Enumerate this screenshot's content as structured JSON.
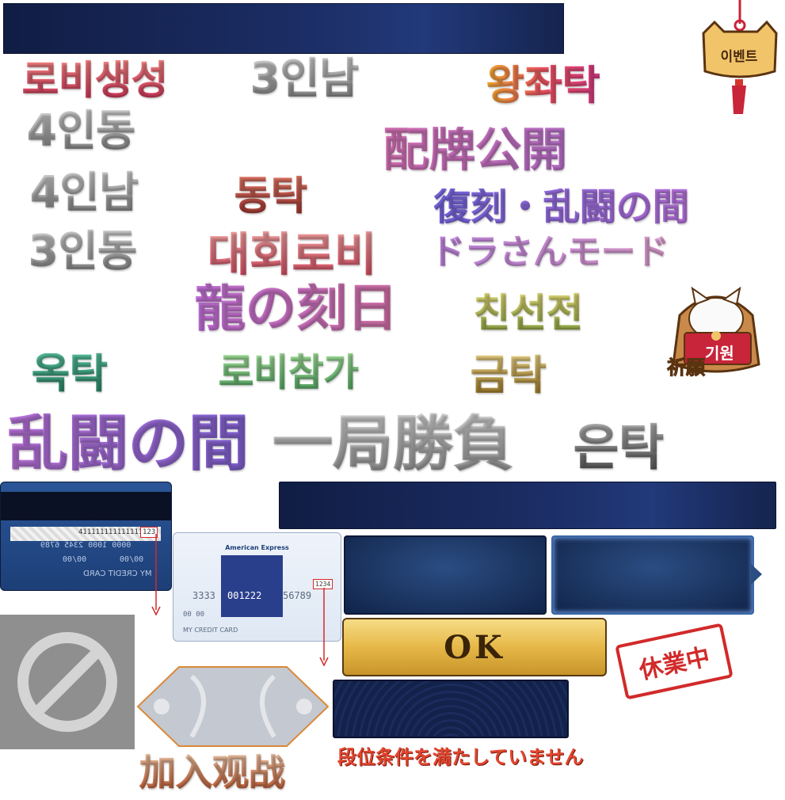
{
  "labels": {
    "event": "이벤트",
    "lobby_create": "로비생성",
    "three_south": "3인남",
    "throne_fall": "왕좌탁",
    "four_east": "4인동",
    "haipai_open": "配牌公開",
    "four_south": "4인남",
    "east_table": "동탁",
    "reprint_chaos": "復刻・乱闘の間",
    "three_east": "3인동",
    "tournament_lobby": "대회로비",
    "dora_mode": "ドラさんモード",
    "dragon_day": "龍の刻日",
    "friendly_match": "친선전",
    "jade_table": "옥탁",
    "lobby_join": "로비참가",
    "gold_table": "금탁",
    "chaos_room": "乱闘の間",
    "one_game": "一局勝負",
    "silver_table": "은탁",
    "wish_ko": "기원",
    "wish_ja": "祈願",
    "ok_button": "OK",
    "closed_stamp": "休業中",
    "rank_condition": "段位条件を満たしていません",
    "join_spectate": "加入观战"
  },
  "cards": {
    "back": {
      "number": "4111111111111111",
      "cvv": "123",
      "digits": "0000 1000 2345 6789",
      "exp1": "00/00",
      "exp2": "00/00",
      "name": "MY CREDIT CARD"
    },
    "front": {
      "brand": "American Express",
      "cid": "1234",
      "num_left": "3333",
      "num_mid": "001222",
      "num_right": "56789",
      "exp": "00 00",
      "name": "MY CREDIT CARD"
    }
  },
  "colors": {
    "navy": "#1c2e66",
    "gold": "#e7c05a",
    "stamp_red": "#d22a2a",
    "rank_red": "#e2462e"
  },
  "icons": {
    "prohibited": "prohibited-icon",
    "lucky_cat": "lucky-cat-icon",
    "event_bell": "event-bell-icon"
  }
}
